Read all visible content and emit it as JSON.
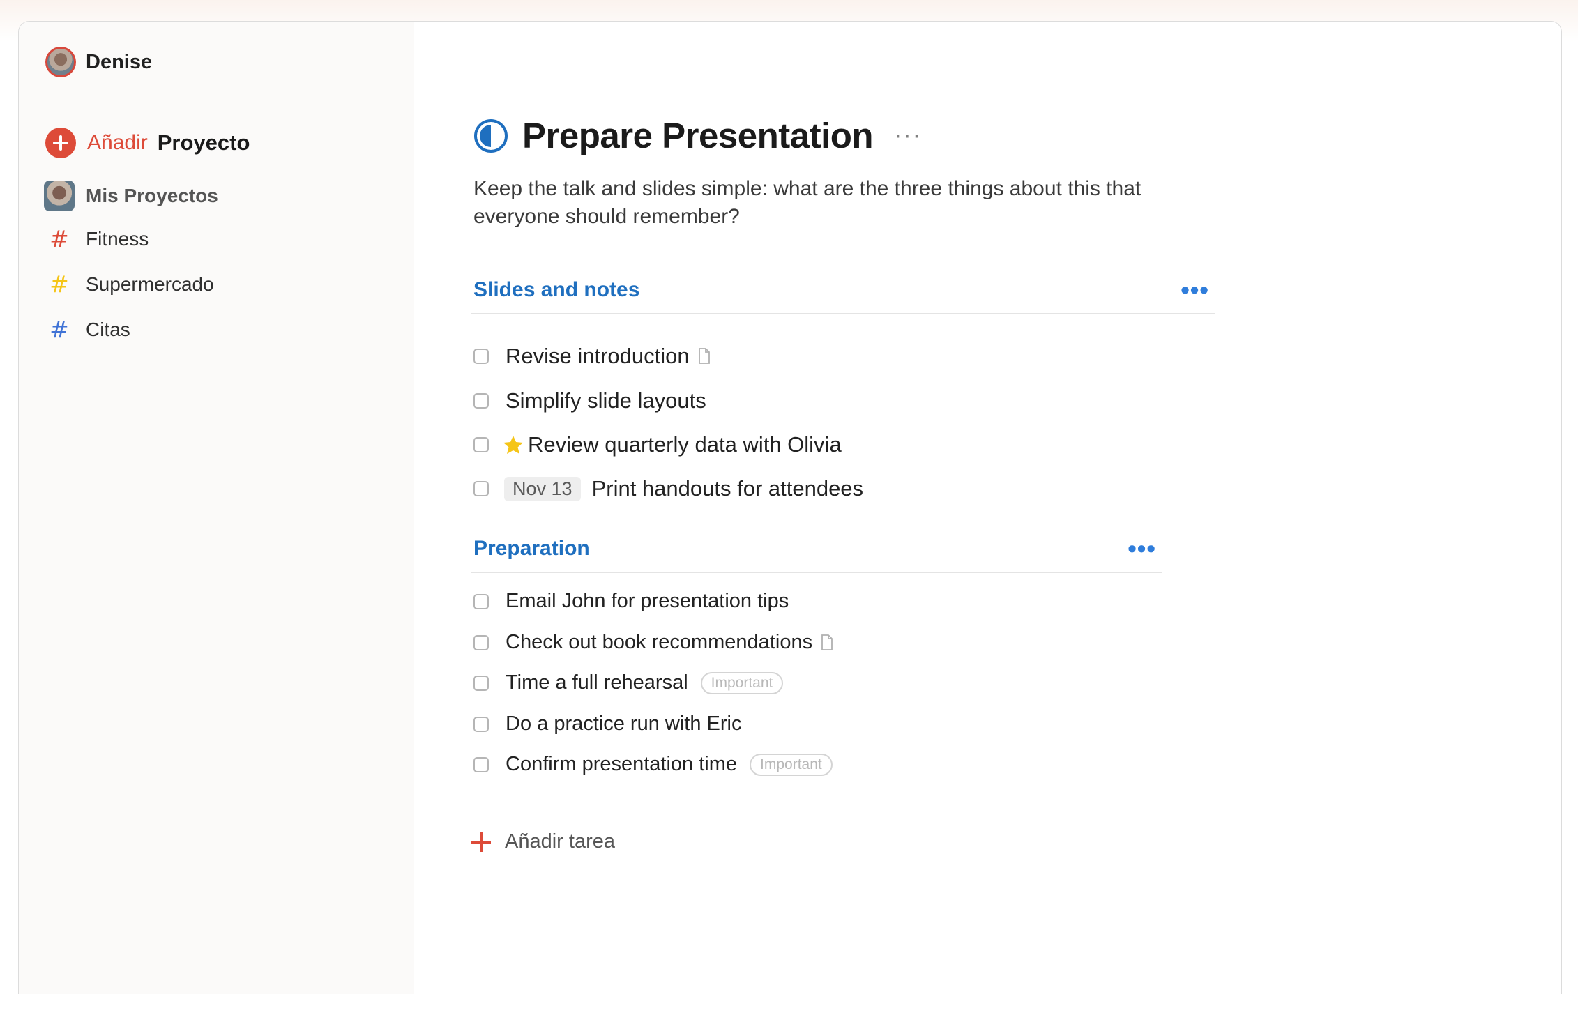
{
  "sidebar": {
    "user_name": "Denise",
    "add_project": {
      "verb": "Añadir",
      "noun": "Proyecto"
    },
    "items": [
      {
        "label": "Mis Proyectos",
        "icon": "avatar"
      },
      {
        "label": "Fitness",
        "icon": "hash-icon",
        "color": "#dd4b39"
      },
      {
        "label": "Supermercado",
        "icon": "hash-icon",
        "color": "#f5c518"
      },
      {
        "label": "Citas",
        "icon": "hash-icon",
        "color": "#4073d6"
      }
    ]
  },
  "project": {
    "title": "Prepare Presentation",
    "more": "···",
    "description": "Keep the talk and slides simple: what are the three things about this that everyone should remember?",
    "accent": "#1f6fbf"
  },
  "sections": [
    {
      "title": "Slides and notes",
      "more": "•••",
      "tasks": [
        {
          "text": "Revise introduction",
          "note": true
        },
        {
          "text": "Simplify slide layouts"
        },
        {
          "text": "Review quarterly data with Olivia",
          "starred": true
        },
        {
          "text": "Print handouts for attendees",
          "date": "Nov 13"
        }
      ]
    },
    {
      "title": "Preparation",
      "more": "•••",
      "tasks": [
        {
          "text": "Email John for presentation tips"
        },
        {
          "text": "Check out book recommendations",
          "note": true
        },
        {
          "text": "Time a full rehearsal",
          "label": "Important"
        },
        {
          "text": "Do a practice run with Eric"
        },
        {
          "text": "Confirm presentation time",
          "label": "Important"
        }
      ]
    }
  ],
  "add_task": "Añadir tarea"
}
